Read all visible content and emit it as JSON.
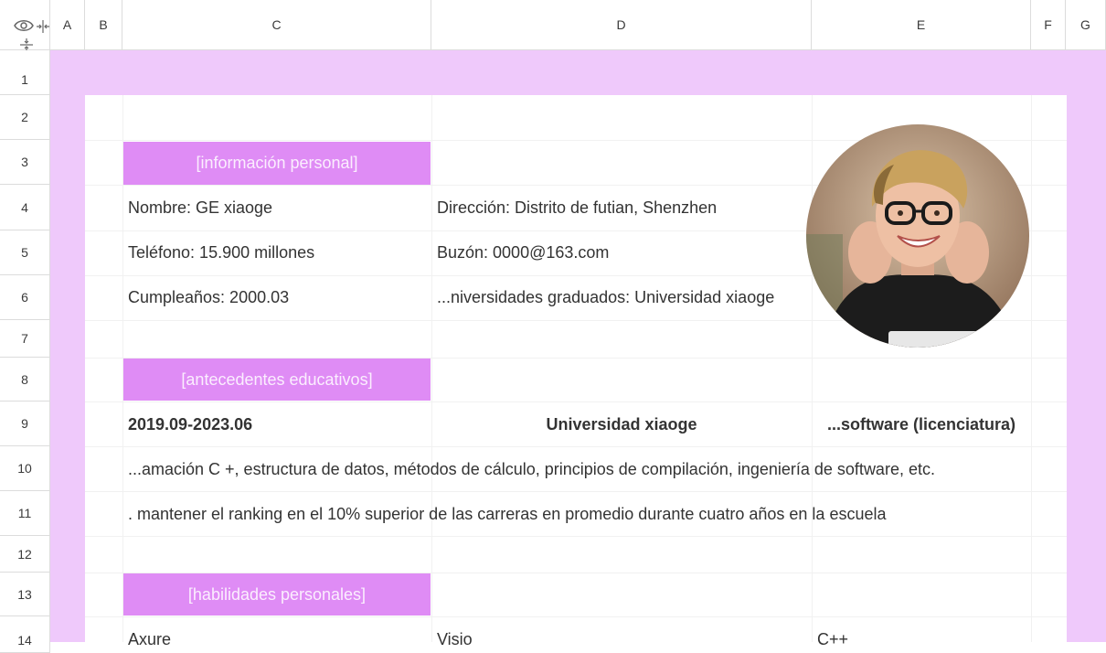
{
  "columns": [
    "A",
    "B",
    "C",
    "D",
    "E",
    "F",
    "G"
  ],
  "rows": [
    "1",
    "2",
    "3",
    "4",
    "5",
    "6",
    "7",
    "8",
    "9",
    "10",
    "11",
    "12",
    "13",
    "14"
  ],
  "sections": {
    "personal": "[información personal]",
    "education": "[antecedentes educativos]",
    "skills": "[habilidades personales]"
  },
  "personal_info": {
    "name": "Nombre: GE xiaoge",
    "address": "Dirección: Distrito de futian, Shenzhen",
    "phone": "Teléfono: 15.900 millones",
    "email": "Buzón: 0000@163.com",
    "birthday": "Cumpleaños: 2000.03",
    "university": "...niversidades graduados: Universidad xiaoge"
  },
  "education": {
    "period": "2019.09-2023.06",
    "school": "Universidad xiaoge",
    "degree": "...software (licenciatura)",
    "courses": "...amación C +, estructura de datos, métodos de cálculo, principios de compilación, ingeniería de software, etc.",
    "ranking": ". mantener el ranking en el 10% superior de las carreras en promedio durante cuatro años en la escuela"
  },
  "skills": [
    "Axure",
    "Visio",
    "C++"
  ],
  "colors": {
    "purple_background": "#efc9fb",
    "section_header": "#df8cf5"
  }
}
